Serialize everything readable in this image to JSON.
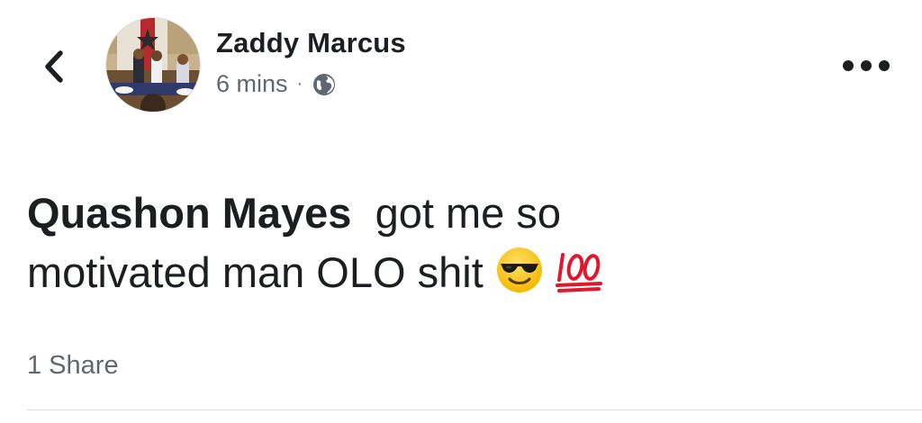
{
  "header": {
    "back_icon": "chevron-left-icon",
    "author_name": "Zaddy Marcus",
    "timestamp": "6 mins",
    "separator": "·",
    "privacy_icon": "globe-icon",
    "more_icon": "more-horizontal-icon"
  },
  "post": {
    "mention": "Quashon Mayes",
    "text_line_1": "got me so",
    "text_line_2": "motivated man OLO shit",
    "emojis": [
      "smiling-face-with-sunglasses-icon",
      "hundred-points-icon"
    ]
  },
  "footer": {
    "share_count": "1 Share"
  },
  "colors": {
    "text_primary": "#1c1e21",
    "text_secondary": "#606770",
    "divider": "#dadde1",
    "hundred_red": "#e0182d",
    "emoji_yellow": "#ffcc33"
  }
}
